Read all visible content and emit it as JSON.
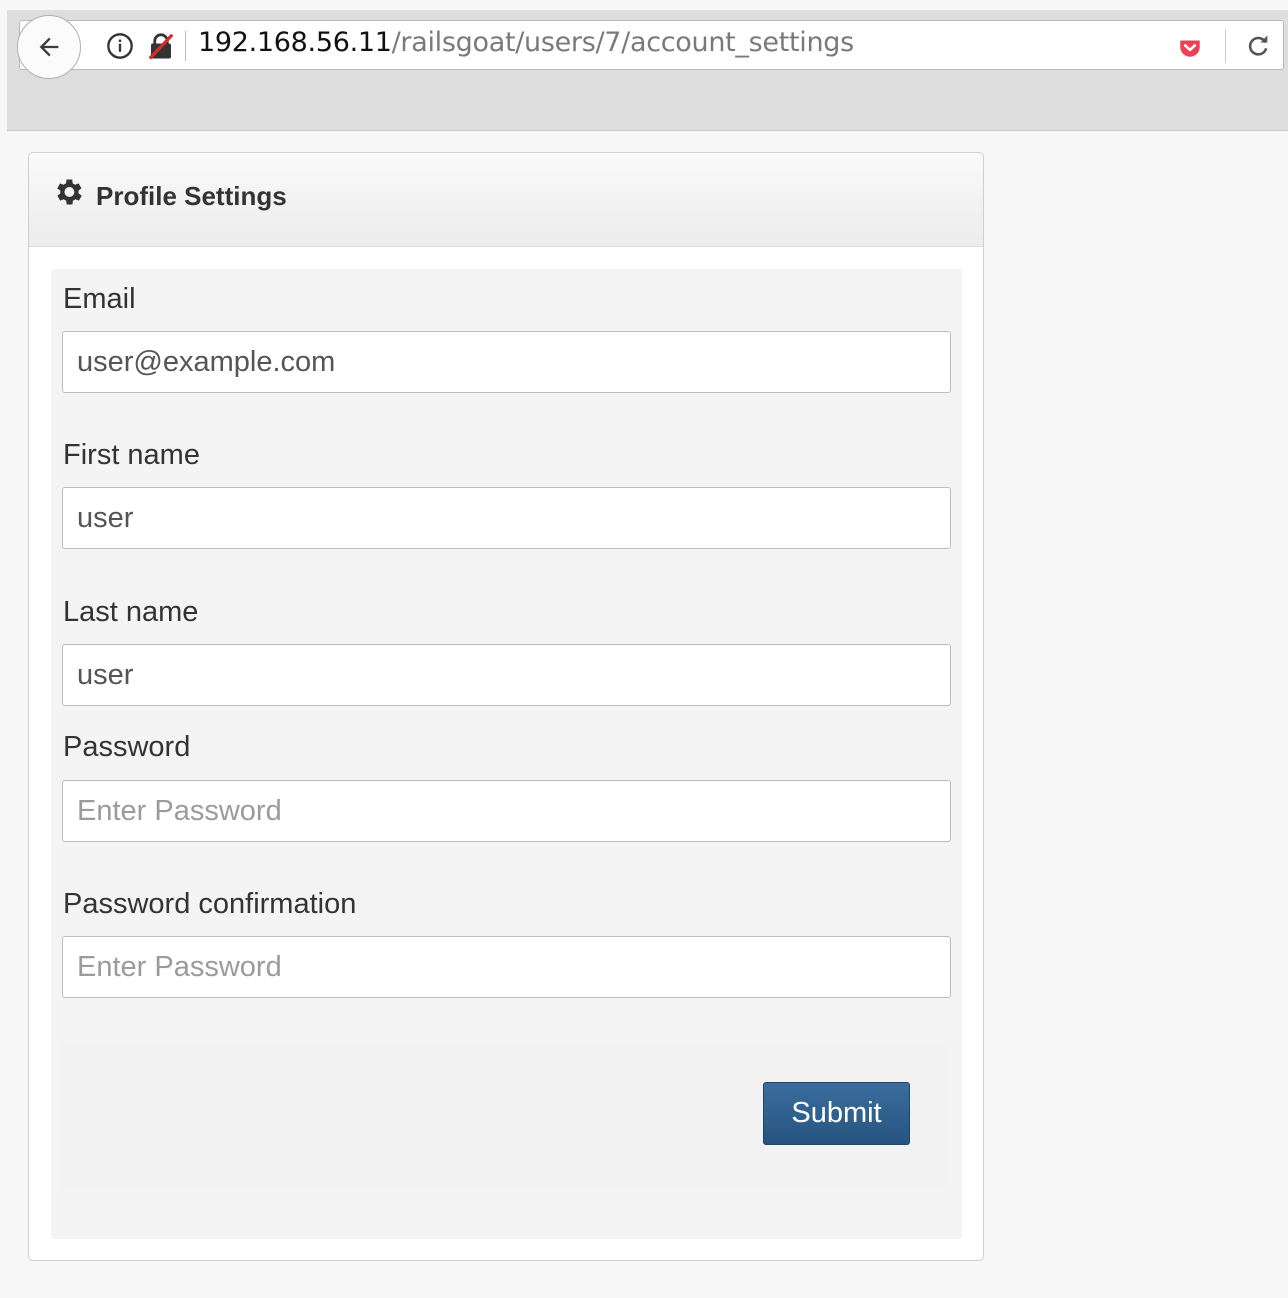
{
  "browser": {
    "url_host": "192.168.56.11",
    "url_path": "/railsgoat/users/7/account_settings"
  },
  "panel": {
    "title": "Profile Settings"
  },
  "form": {
    "email": {
      "label": "Email",
      "value": "user@example.com"
    },
    "first_name": {
      "label": "First name",
      "value": "user"
    },
    "last_name": {
      "label": "Last name",
      "value": "user"
    },
    "password": {
      "label": "Password",
      "placeholder": "Enter Password"
    },
    "password_confirmation": {
      "label": "Password confirmation",
      "placeholder": "Enter Password"
    },
    "submit_label": "Submit"
  },
  "colors": {
    "submit_button": "#2f6090",
    "chrome_background": "#dedede"
  },
  "icons": {
    "back": "back-arrow-icon",
    "info": "info-icon",
    "insecure": "insecure-lock-icon",
    "pocket": "pocket-icon",
    "reload": "reload-icon",
    "settings": "gear-icon"
  }
}
